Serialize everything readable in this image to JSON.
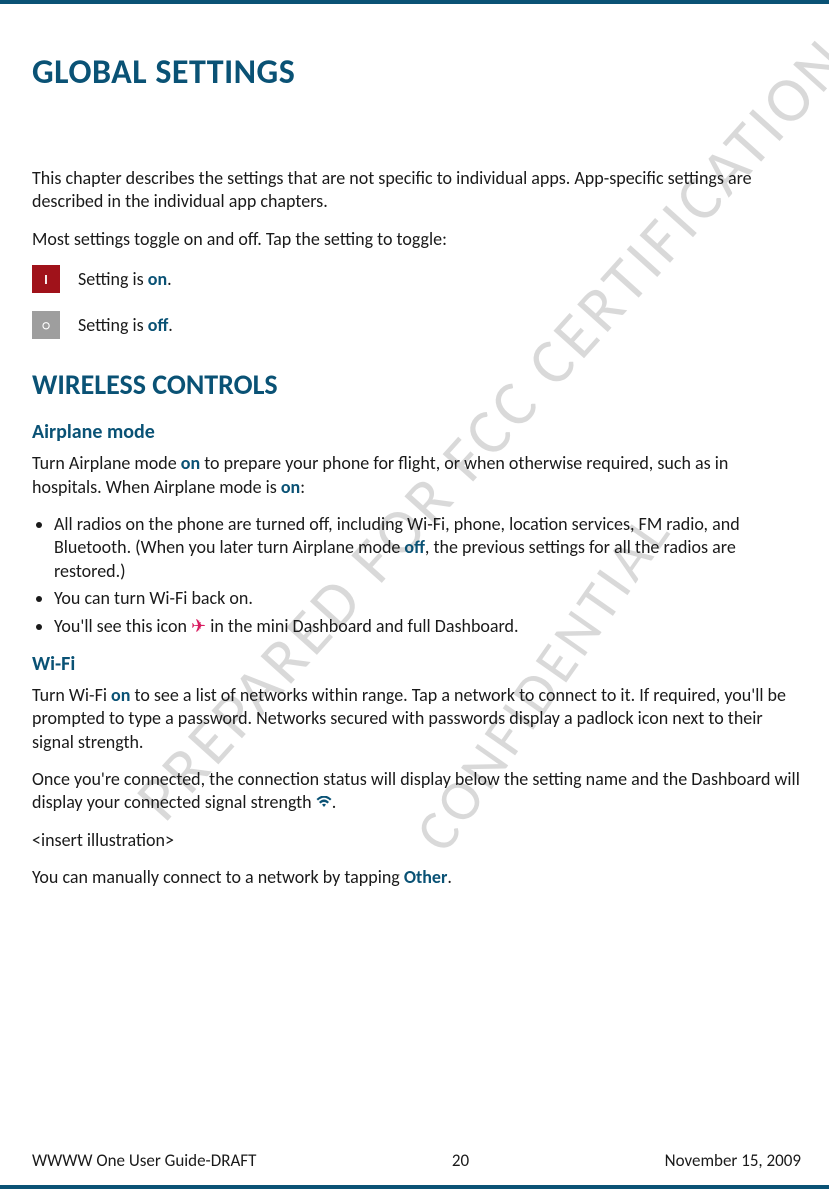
{
  "watermarks": {
    "wm1": "PREPARED FOR FCC CERTIFICATION",
    "wm2": "CONFIDENTIAL"
  },
  "title": "GLOBAL SETTINGS",
  "intro1": "This chapter describes the settings that are not specific to individual apps. App-specific settings are described in the individual app chapters.",
  "intro2": "Most settings toggle on and off. Tap the setting to toggle:",
  "toggle": {
    "on_glyph": "I",
    "on_pre": "Setting is ",
    "on_kw": "on",
    "on_post": ".",
    "off_glyph": "○",
    "off_pre": "Setting is ",
    "off_kw": "off",
    "off_post": "."
  },
  "section_wireless": "WIRELESS CONTROLS",
  "airplane": {
    "heading": "Airplane mode",
    "p_pre": "Turn Airplane mode ",
    "p_kw1": "on",
    "p_mid": " to prepare your phone for flight, or when otherwise required, such as in hospitals. When Airplane mode is ",
    "p_kw2": "on",
    "p_post": ":",
    "b1_pre": "All radios on the phone are turned off, including Wi-Fi, phone, location services, FM radio, and Bluetooth. (When you later turn Airplane mode ",
    "b1_kw": "off",
    "b1_post": ", the previous settings for all the radios are restored.)",
    "b2": "You can turn Wi-Fi back on.",
    "b3_pre": "You'll see this icon ",
    "b3_post": " in the mini Dashboard and full Dashboard."
  },
  "wifi": {
    "heading": "Wi-Fi",
    "p1_pre": "Turn Wi-Fi ",
    "p1_kw": "on",
    "p1_post": " to see a list of networks within range. Tap a network to connect to it. If required, you'll be prompted to type a password. Networks secured with passwords display a padlock icon next to their signal strength.",
    "p2_pre": "Once you're connected, the connection status will display below the setting name and the Dashboard will display your connected signal strength ",
    "p2_post": ".",
    "p3": "<insert illustration>",
    "p4_pre": "You can manually connect to a network by tapping ",
    "p4_kw": "Other",
    "p4_post": "."
  },
  "footer": {
    "left": "WWWW One User Guide-DRAFT",
    "center": "20",
    "right": "November 15, 2009"
  }
}
